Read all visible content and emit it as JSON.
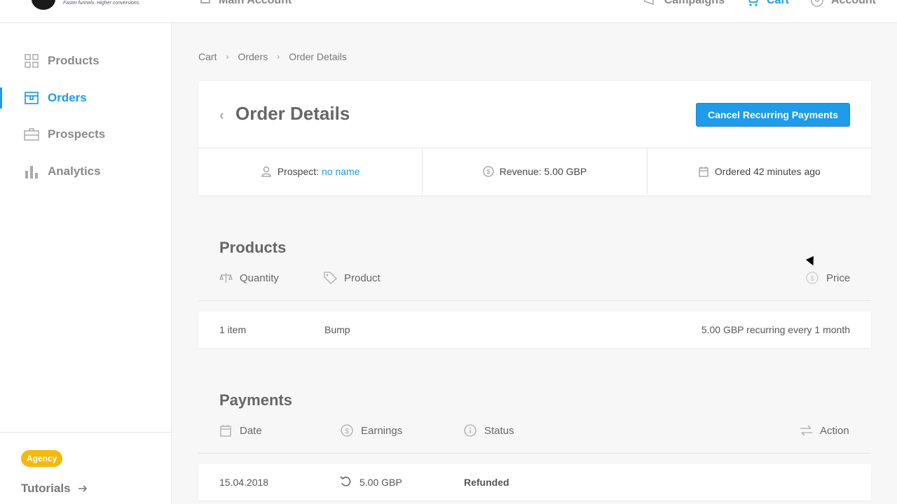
{
  "topbar": {
    "logo_tagline": "Faster funnels. Higher conversions.",
    "account_selector": "Main Account",
    "nav": [
      {
        "label": "Campaigns",
        "icon": "megaphone-icon"
      },
      {
        "label": "Cart",
        "icon": "cart-icon",
        "active": true
      },
      {
        "label": "Account",
        "icon": "user-circle-icon"
      }
    ]
  },
  "sidebar": {
    "items": [
      {
        "label": "Products",
        "icon": "grid-icon"
      },
      {
        "label": "Orders",
        "icon": "box-icon",
        "active": true
      },
      {
        "label": "Prospects",
        "icon": "briefcase-icon"
      },
      {
        "label": "Analytics",
        "icon": "bar-chart-icon"
      }
    ],
    "badge": "Agency",
    "tutorials": "Tutorials"
  },
  "breadcrumb": [
    "Cart",
    "Orders",
    "Order Details"
  ],
  "order": {
    "title": "Order Details",
    "cancel_button": "Cancel Recurring Payments",
    "prospect_label": "Prospect:",
    "prospect_value": "no name",
    "revenue": "Revenue: 5.00 GBP",
    "ordered": "Ordered 42 minutes ago"
  },
  "products": {
    "title": "Products",
    "columns": {
      "quantity": "Quantity",
      "product": "Product",
      "price": "Price"
    },
    "rows": [
      {
        "quantity": "1 item",
        "product": "Bump",
        "price": "5.00 GBP recurring every 1 month"
      }
    ]
  },
  "payments": {
    "title": "Payments",
    "columns": {
      "date": "Date",
      "earnings": "Earnings",
      "status": "Status",
      "action": "Action"
    },
    "rows": [
      {
        "date": "15.04.2018",
        "earnings": "5.00 GBP",
        "status": "Refunded"
      }
    ]
  },
  "colors": {
    "accent": "#1e9be9",
    "badge": "#f5b90d"
  }
}
